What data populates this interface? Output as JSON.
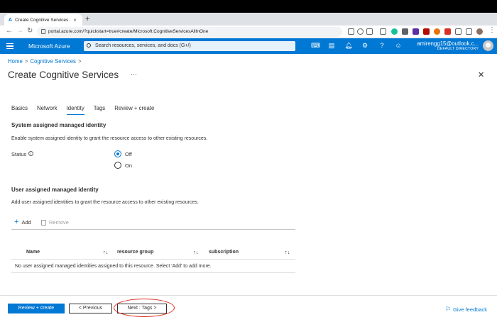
{
  "browser": {
    "tab_title": "Create Cognitive Services - M",
    "url": "portal.azure.com/?quickstart=true#create/Microsoft.CognitiveServicesAllInOne"
  },
  "header": {
    "brand": "Microsoft Azure",
    "search_placeholder": "Search resources, services, and docs (G+/)",
    "account_name": "amirengg15@outlook.c...",
    "directory": "DEFAULT DIRECTORY"
  },
  "breadcrumb": {
    "home": "Home",
    "service": "Cognitive Services"
  },
  "page": {
    "title": "Create Cognitive Services",
    "more": "···"
  },
  "tabs": [
    {
      "label": "Basics"
    },
    {
      "label": "Network"
    },
    {
      "label": "Identity"
    },
    {
      "label": "Tags"
    },
    {
      "label": "Review + create"
    }
  ],
  "active_tab": "Identity",
  "system_identity": {
    "heading": "System assigned managed identity",
    "description": "Enable system assigned identity to grant the resource access to other existing resources.",
    "status_label": "Status",
    "options": [
      "Off",
      "On"
    ],
    "selected": "Off"
  },
  "user_identity": {
    "heading": "User assigned managed identity",
    "description": "Add user assigned identities to grant the resource access to other existing resources.",
    "add_label": "Add",
    "remove_label": "Remove",
    "columns": [
      "Name",
      "resource group",
      "subscription"
    ],
    "empty_message": "No user assigned managed identities assigned to this resource. Select 'Add' to add more."
  },
  "footer": {
    "review_label": "Review + create",
    "previous_label": "< Previous",
    "next_label": "Next : Tags >",
    "feedback_label": "Give feedback"
  },
  "colors": {
    "accent": "#0078d4",
    "annotation": "#d9301f"
  }
}
